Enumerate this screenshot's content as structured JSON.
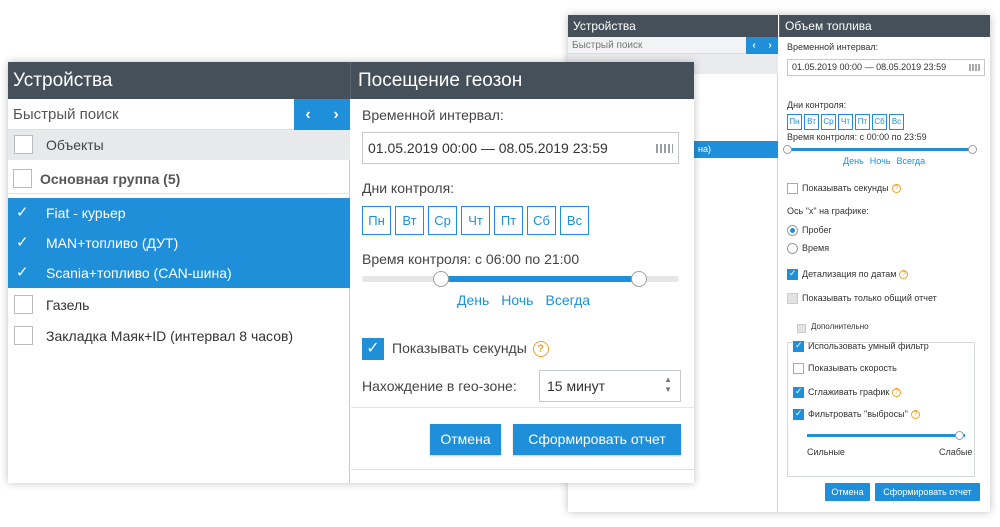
{
  "back": {
    "devices_title": "Устройства",
    "fuel_title": "Объем топлива",
    "search_placeholder": "Быстрый поиск",
    "arrow_left": "‹",
    "arrow_right": "›",
    "selected_fragment": "на)",
    "interval_label": "Временной интервал:",
    "interval_value": "01.05.2019 00:00 — 08.05.2019 23:59",
    "days_label": "Дни контроля:",
    "days": [
      "Пн",
      "Вт",
      "Ср",
      "Чт",
      "Пт",
      "Сб",
      "Вс"
    ],
    "time_label": "Время контроля: с 00:00 по 23:59",
    "links": [
      "День",
      "Ночь",
      "Всегда"
    ],
    "show_seconds": "Показывать секунды",
    "x_axis_label": "Ось \"х\" на графике:",
    "radio_mileage": "Пробег",
    "radio_time": "Время",
    "detail_by_dates": "Детализация по датам",
    "only_total": "Показывать только общий отчет",
    "additional": "Дополнительно",
    "smart_filter": "Использовать умный фильтр",
    "show_speed": "Показывать скорость",
    "smooth_chart": "Сглаживать график",
    "filter_outliers": "Фильтровать \"выбросы\"",
    "strong": "Сильные",
    "weak": "Слабые",
    "cancel": "Отмена",
    "generate": "Сформировать отчет"
  },
  "front": {
    "devices_title": "Устройства",
    "geozone_title": "Посещение геозон",
    "search_placeholder": "Быстрый поиск",
    "arrow_left": "‹",
    "arrow_right": "›",
    "objects_header": "Объекты",
    "group": "Основная группа (5)",
    "items": [
      "Fiat - курьер",
      "MAN+топливо (ДУТ)",
      "Scania+топливо (CAN-шина)",
      "Газель",
      "Закладка Маяк+ID (интервал 8 часов)"
    ],
    "interval_label": "Временной интервал:",
    "interval_value": "01.05.2019 00:00 — 08.05.2019 23:59",
    "days_label": "Дни контроля:",
    "days": [
      "Пн",
      "Вт",
      "Ср",
      "Чт",
      "Пт",
      "Сб",
      "Вс"
    ],
    "time_label": "Время контроля: с 06:00 по 21:00",
    "time_from": "06:00",
    "time_to": "21:00",
    "links": [
      "День",
      "Ночь",
      "Всегда"
    ],
    "show_seconds": "Показывать секунды",
    "geozone_stay_label": "Нахождение в гео-зоне:",
    "geozone_stay_value": "15  минут",
    "cancel": "Отмена",
    "generate": "Сформировать отчет"
  },
  "colors": {
    "accent": "#1e8fd8",
    "header_bg": "#45505a",
    "help_icon": "#f0a020"
  }
}
